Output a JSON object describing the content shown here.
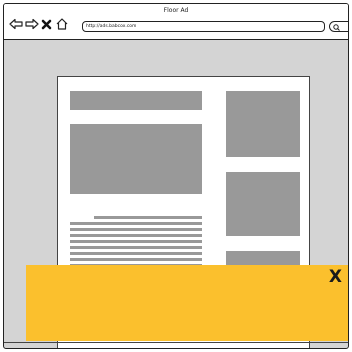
{
  "window": {
    "title": "Floor Ad"
  },
  "toolbar": {
    "url": "http://ads.babcox.com",
    "icons": [
      "back-arrow-icon",
      "forward-arrow-icon",
      "close-icon",
      "home-icon",
      "search-icon"
    ]
  },
  "floor_ad": {
    "close_label": "X",
    "color": "#fbc02d"
  },
  "colors": {
    "placeholder_block": "#999999",
    "window_background": "#d4d4d4"
  }
}
